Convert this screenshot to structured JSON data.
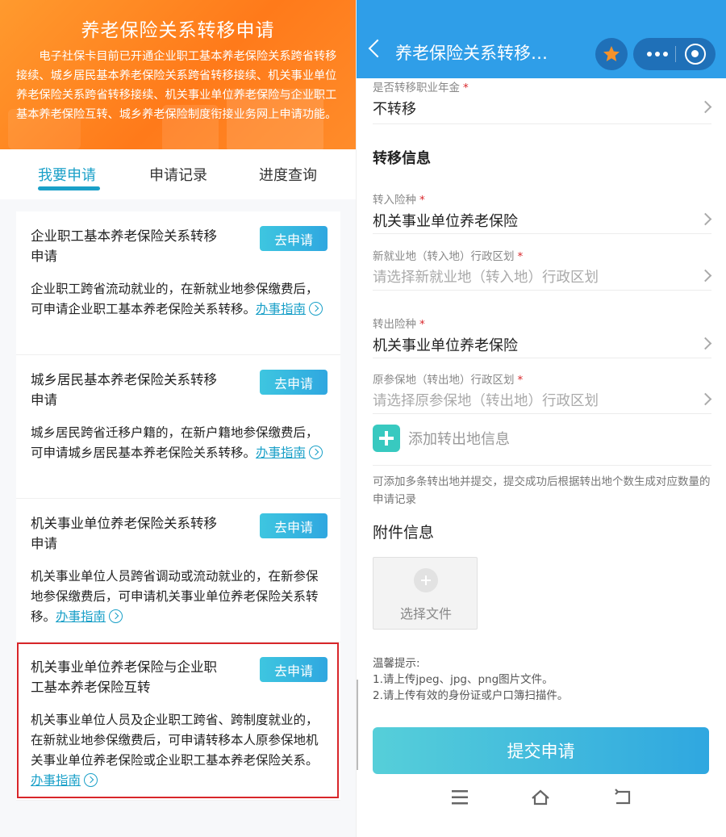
{
  "left": {
    "banner": {
      "title": "养老保险关系转移申请",
      "description": "电子社保卡目前已开通企业职工基本养老保险关系跨省转移接续、城乡居民基本养老保险关系跨省转移接续、机关事业单位养老保险关系跨省转移接续、机关事业单位养老保险与企业职工基本养老保险互转、城乡养老保险制度衔接业务网上申请功能。"
    },
    "tabs": [
      {
        "label": "我要申请",
        "active": true
      },
      {
        "label": "申请记录",
        "active": false
      },
      {
        "label": "进度查询",
        "active": false
      }
    ],
    "apply_label": "去申请",
    "guide_label": "办事指南",
    "cards": [
      {
        "title": "企业职工基本养老保险关系转移申请",
        "description": "企业职工跨省流动就业的，在新就业地参保缴费后，可申请企业职工基本养老保险关系转移。"
      },
      {
        "title": "城乡居民基本养老保险关系转移申请",
        "description": "城乡居民跨省迁移户籍的，在新户籍地参保缴费后，可申请城乡居民基本养老保险关系转移。"
      },
      {
        "title": "机关事业单位养老保险关系转移申请",
        "description": "机关事业单位人员跨省调动或流动就业的，在新参保地参保缴费后，可申请机关事业单位养老保险关系转移。"
      },
      {
        "title": "机关事业单位养老保险与企业职工基本养老保险互转",
        "description": "机关事业单位人员及企业职工跨省、跨制度就业的，在新就业地参保缴费后，可申请转移本人原参保地机关事业单位养老保险或企业职工基本养老保险关系。"
      }
    ]
  },
  "right": {
    "nav": {
      "title": "养老保险关系转移…",
      "star_color": "#f5922a",
      "bar_color": "#2f9ee8"
    },
    "fields": {
      "occupational_annuity": {
        "label": "是否转移职业年金",
        "value": "不转移"
      },
      "transfer_in_type": {
        "label": "转入险种",
        "value": "机关事业单位养老保险"
      },
      "new_region": {
        "label": "新就业地（转入地）行政区划",
        "placeholder": "请选择新就业地（转入地）行政区划"
      },
      "transfer_out_type": {
        "label": "转出险种",
        "value": "机关事业单位养老保险"
      },
      "orig_region": {
        "label": "原参保地（转出地）行政区划",
        "placeholder": "请选择原参保地（转出地）行政区划"
      }
    },
    "section_transfer": "转移信息",
    "add_out_label": "添加转出地信息",
    "add_hint": "可添加多条转出地并提交，提交成功后根据转出地个数生成对应数量的申请记录",
    "attach_title": "附件信息",
    "upload_label": "选择文件",
    "tips": {
      "heading": "温馨提示:",
      "line1": "1.请上传jpeg、jpg、png图片文件。",
      "line2": "2.请上传有效的身份证或户口簿扫描件。"
    },
    "submit_label": "提交申请",
    "required_mark": "*"
  }
}
